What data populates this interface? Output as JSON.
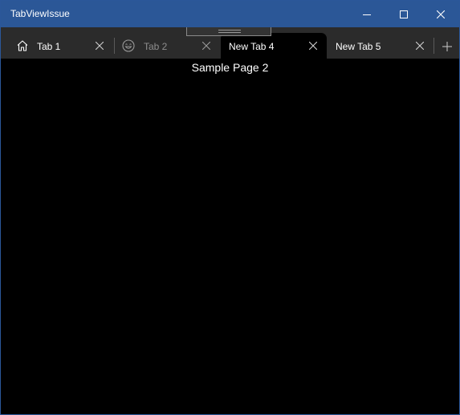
{
  "window": {
    "title": "TabViewIssue"
  },
  "caption_buttons": {
    "minimize_icon": "minimize-icon",
    "maximize_icon": "maximize-icon",
    "close_icon": "close-icon"
  },
  "tabs": [
    {
      "label": "Tab 1",
      "icon": "home-icon",
      "selected": false
    },
    {
      "label": "Tab 2",
      "icon": "emoji-icon",
      "selected": false
    },
    {
      "label": "New Tab 4",
      "icon": "",
      "selected": true
    },
    {
      "label": "New Tab 5",
      "icon": "",
      "selected": false
    }
  ],
  "add_tab_icon": "plus-icon",
  "content": {
    "text": "Sample Page 2"
  },
  "colors": {
    "titlebar": "#2b5797",
    "tabstrip": "#2b2b2b",
    "content_background": "#000000",
    "text": "#ffffff"
  }
}
